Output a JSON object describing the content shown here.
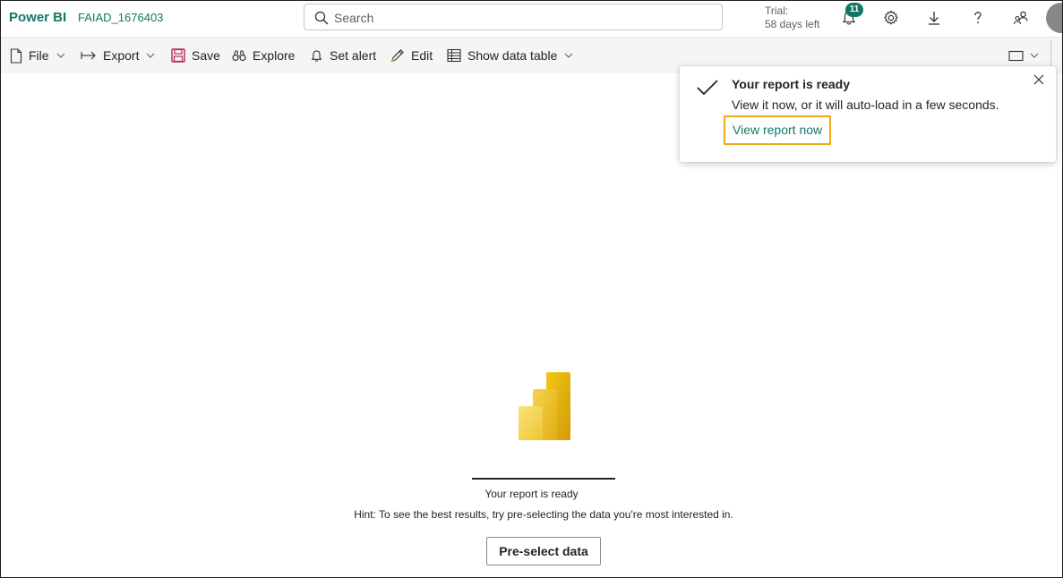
{
  "header": {
    "brand": "Power BI",
    "workspace": "FAIAD_1676403",
    "search_placeholder": "Search",
    "trial_label": "Trial:",
    "trial_days": "58 days left",
    "notification_count": "11"
  },
  "commands": {
    "file": "File",
    "export": "Export",
    "save": "Save",
    "explore": "Explore",
    "set_alert": "Set alert",
    "edit": "Edit",
    "show_data_table": "Show data table"
  },
  "toast": {
    "title": "Your report is ready",
    "body": "View it now, or it will auto-load in a few seconds.",
    "link": "View report now"
  },
  "main": {
    "status": "Your report is ready",
    "hint": "Hint: To see the best results, try pre-selecting the data you're most interested in.",
    "preselect_label": "Pre-select data"
  },
  "colors": {
    "brand": "#117865",
    "highlight": "#f2a818",
    "logo_light": "#f2c811",
    "logo_dark": "#d29a0a"
  }
}
